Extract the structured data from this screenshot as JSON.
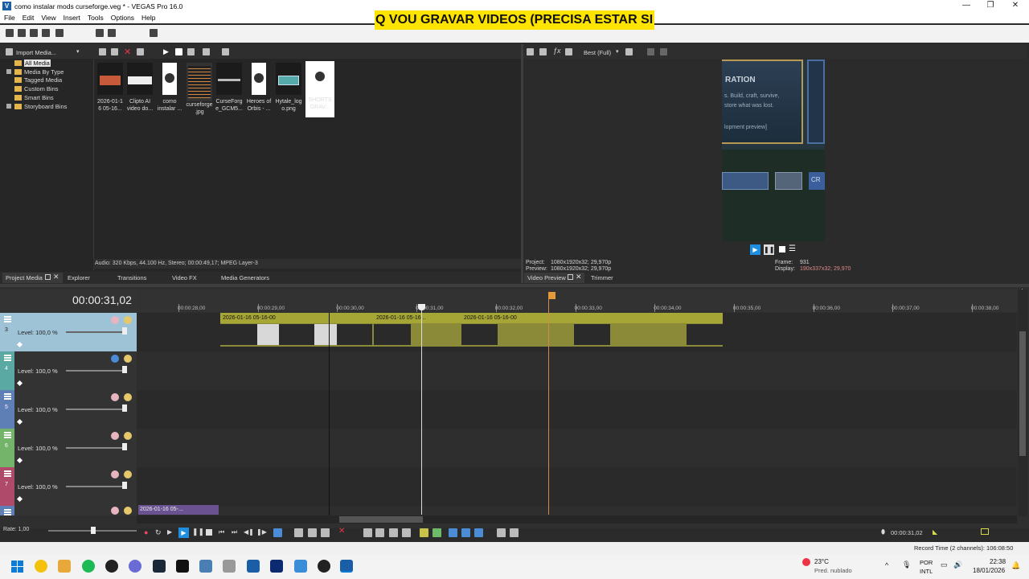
{
  "window": {
    "title": "como instalar mods curseforge.veg * - VEGAS Pro 16.0",
    "minimize": "—",
    "maximize": "❐",
    "close": "✕"
  },
  "menu": [
    "File",
    "Edit",
    "View",
    "Insert",
    "Tools",
    "Options",
    "Help"
  ],
  "banner": {
    "text": "Q VOU GRAVAR VIDEOS (PRECISA ESTAR SI"
  },
  "media_panel": {
    "import_label": "Import Media...",
    "tree": [
      "All Media",
      "Media By Type",
      "Tagged Media",
      "Custom Bins",
      "Smart Bins",
      "Storyboard Bins"
    ],
    "thumbs": [
      {
        "l1": "2026-01-1",
        "l2": "6 05-16..."
      },
      {
        "l1": "Clipto AI",
        "l2": "video do..."
      },
      {
        "l1": "como",
        "l2": "instalar ..."
      },
      {
        "l1": "curseforge",
        "l2": ".jpg"
      },
      {
        "l1": "CurseForg",
        "l2": "e_GCM5..."
      },
      {
        "l1": "Heroes of",
        "l2": "Orbis - ..."
      },
      {
        "l1": "Hytale_log",
        "l2": "o.png"
      },
      {
        "l1": "SHORTS",
        "l2": "GRAV..."
      }
    ],
    "status": "Audio: 320 Kbps, 44.100 Hz, Stereo; 00:00:49,17; MPEG Layer-3",
    "tabs": [
      "Project Media",
      "Explorer",
      "Transitions",
      "Video FX",
      "Media Generators"
    ]
  },
  "preview": {
    "quality": "Best (Full)",
    "screen": {
      "heading": "RATION",
      "line1": "s. Build, craft, survive,",
      "line2": "store what was lost.",
      "line3": "lopment preview]",
      "btn": "CR"
    },
    "project_label": "Project:",
    "project_value": "1080x1920x32; 29,970p",
    "preview_label": "Preview:",
    "preview_value": "1080x1920x32; 29,970p",
    "frame_label": "Frame:",
    "frame_value": "931",
    "display_label": "Display:",
    "display_value": "190x337x32; 29,970",
    "tabs": [
      "Video Preview",
      "Trimmer"
    ]
  },
  "timeline": {
    "timecode": "00:00:31,02",
    "ruler": [
      "00:00:28,00",
      "00:00:29,00",
      "00:00:30,00",
      "00:00:31,00",
      "00:00:32,00",
      "00:00:33,00",
      "00:00:34,00",
      "00:00:35,00",
      "00:00:36,00",
      "00:00:37,00",
      "00:00:38,00"
    ],
    "tracks": [
      {
        "num": "3",
        "level": "Level: 100,0 %",
        "color": "#9fc3d6"
      },
      {
        "num": "4",
        "level": "Level: 100,0 %",
        "color": "#5aa9a3"
      },
      {
        "num": "5",
        "level": "Level: 100,0 %",
        "color": "#5d7fb6"
      },
      {
        "num": "6",
        "level": "Level: 100,0 %",
        "color": "#74b36a"
      },
      {
        "num": "7",
        "level": "Level: 100,0 %",
        "color": "#b04a6a"
      }
    ],
    "clips": [
      "2026-01-16 05-16-00",
      "2026-01-16 05-16...",
      "2026-01-16 05-16-00"
    ],
    "bottom_clip": "2026-01-16 05-...",
    "rate": "Rate: 1,00",
    "end_timecode": "00:00:31,02",
    "record_time": "Record Time (2 channels): 106:08:50"
  },
  "taskbar": {
    "weather_temp": "23°C",
    "weather_desc": "Pred. nublado",
    "lang1": "POR",
    "lang2": "INTL",
    "time": "22:38",
    "date": "18/01/2026",
    "icon_colors": [
      "#0a7cd8",
      "#e8a93a",
      "#1db954",
      "#222",
      "#6b6bd6",
      "#111",
      "#222",
      "#4a7fb5",
      "#999",
      "#1a5ea8",
      "#0b2a6f",
      "#3a8ed8",
      "#222",
      "#1a5ea8"
    ]
  }
}
